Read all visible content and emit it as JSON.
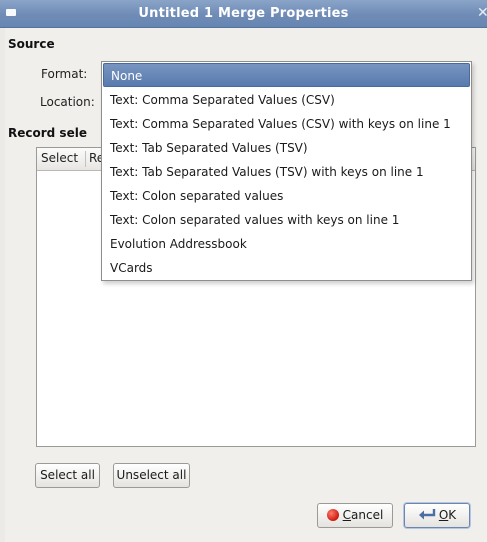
{
  "window": {
    "title": "Untitled 1 Merge Properties",
    "close_glyph": "✕"
  },
  "source": {
    "heading": "Source",
    "format_label": "Format:",
    "location_label": "Location:"
  },
  "records": {
    "heading": "Record sele",
    "columns": [
      "Select",
      "Re"
    ]
  },
  "format_dropdown": {
    "selected": "None",
    "options": [
      "None",
      "Text: Comma Separated Values (CSV)",
      "Text: Comma Separated Values (CSV) with keys on line 1",
      "Text: Tab Separated Values (TSV)",
      "Text: Tab Separated Values (TSV) with keys on line 1",
      "Text: Colon separated values",
      "Text: Colon separated values with keys on line 1",
      "Evolution Addressbook",
      "VCards"
    ]
  },
  "buttons": {
    "select_all": "Select all",
    "unselect_all": "Unselect all",
    "cancel_mnemonic": "C",
    "cancel_rest": "ancel",
    "ok_mnemonic": "O",
    "ok_rest": "K"
  },
  "colors": {
    "titlebar": "#6f8cb6",
    "selection": "#587aae",
    "background": "#f0efec"
  }
}
